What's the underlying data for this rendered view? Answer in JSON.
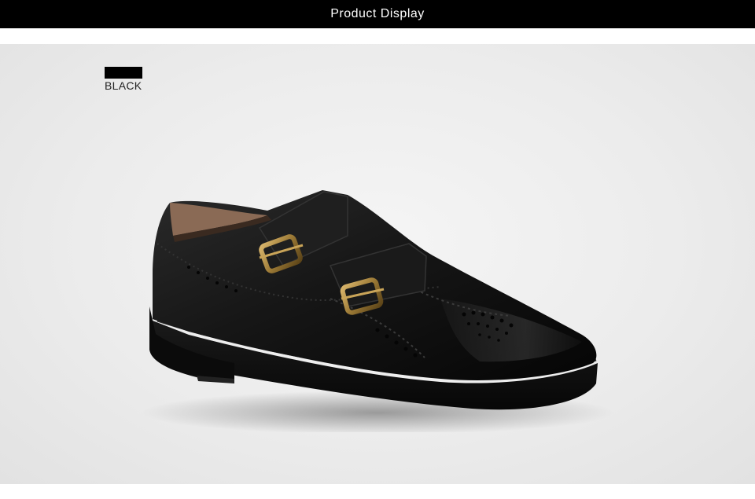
{
  "header": {
    "title": "Product Display",
    "background": "#000000",
    "text_color": "#ffffff"
  },
  "product": {
    "color_name": "BLACK",
    "swatch_color": "#000000",
    "image_icon": "monk-strap-brogue-shoe"
  }
}
